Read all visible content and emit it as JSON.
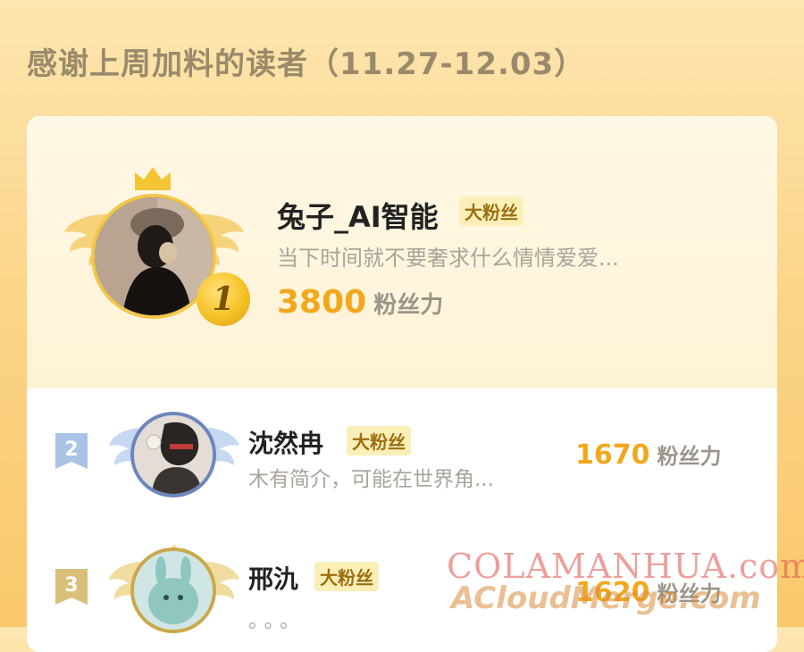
{
  "heading": "感谢上周加料的读者（11.27-12.03）",
  "first": {
    "rank": "1",
    "name": "兔子_AI智能",
    "tag": "大粉丝",
    "bio": "当下时间就不要奢求什么情情爱爱...",
    "score": "3800",
    "unit": "粉丝力"
  },
  "rows": [
    {
      "rank": "2",
      "name": "沈然冉",
      "tag": "大粉丝",
      "bio": "木有简介，可能在世界角...",
      "score": "1670",
      "unit": "粉丝力"
    },
    {
      "rank": "3",
      "name": "邢氿",
      "tag": "大粉丝",
      "bio": "。。。",
      "score": "1620",
      "unit": "粉丝力"
    }
  ],
  "watermark": {
    "line1": "COLAMANHUA.com",
    "line2": "ACloudMerge.com"
  },
  "colors": {
    "accent": "#f2a81d",
    "gold": "#f2c64a",
    "silver": "#a9c3e6",
    "bronze": "#d9c07a"
  },
  "icons": [
    "crown-icon",
    "wing-icon",
    "rank-badge-icon"
  ]
}
